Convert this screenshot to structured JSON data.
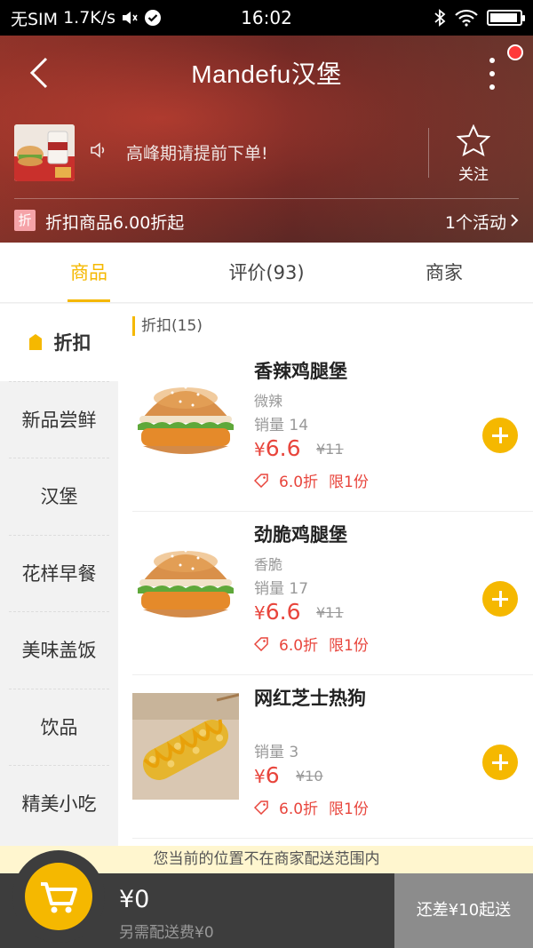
{
  "status_bar": {
    "carrier": "无SIM",
    "speed": "1.7K/s",
    "time": "16:02"
  },
  "header": {
    "title": "Mandefu汉堡",
    "notice": "高峰期请提前下单!",
    "follow_label": "关注",
    "discount_badge": "折",
    "promo_text": "折扣商品6.00折起",
    "activity_link": "1个活动"
  },
  "tabs": [
    {
      "label": "商品",
      "active": true
    },
    {
      "label": "评价(93)",
      "active": false
    },
    {
      "label": "商家",
      "active": false
    }
  ],
  "sidebar": {
    "items": [
      {
        "label": "折扣",
        "active": true
      },
      {
        "label": "新品尝鲜"
      },
      {
        "label": "汉堡"
      },
      {
        "label": "花样早餐"
      },
      {
        "label": "美味盖饭"
      },
      {
        "label": "饮品"
      },
      {
        "label": "精美小吃"
      }
    ]
  },
  "category_header": "折扣(15)",
  "products": [
    {
      "name": "香辣鸡腿堡",
      "subtitle": "微辣",
      "sales": "销量 14",
      "currency": "¥",
      "price": "6.6",
      "original_price": "¥11",
      "discount": "6.0折",
      "limit": "限1份",
      "image": "burger"
    },
    {
      "name": "劲脆鸡腿堡",
      "subtitle": "香脆",
      "sales": "销量 17",
      "currency": "¥",
      "price": "6.6",
      "original_price": "¥11",
      "discount": "6.0折",
      "limit": "限1份",
      "image": "burger"
    },
    {
      "name": "网红芝士热狗",
      "subtitle": "",
      "sales": "销量 3",
      "currency": "¥",
      "price": "6",
      "original_price": "¥10",
      "discount": "6.0折",
      "limit": "限1份",
      "image": "cheese-hotdog"
    }
  ],
  "delivery_notice": "您当前的位置不在商家配送范围内",
  "cart": {
    "total": "¥0",
    "delivery_fee": "另需配送费¥0",
    "checkout_label": "还差¥10起送"
  },
  "colors": {
    "accent": "#f5b800",
    "price_red": "#e8453c",
    "cart_bar": "#3d3d3d"
  }
}
